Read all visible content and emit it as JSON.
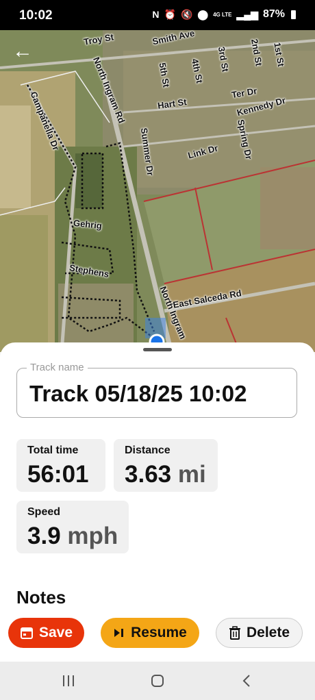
{
  "status": {
    "time": "10:02",
    "network": "4G LTE",
    "battery": "87%",
    "icons": [
      "nfc-icon",
      "alarm-icon",
      "mute-icon",
      "location-icon",
      "signal-icon",
      "battery-icon"
    ]
  },
  "map": {
    "streets": [
      "Troy St",
      "Smith Ave",
      "North Ingram Rd",
      "5th St",
      "4th St",
      "3rd St",
      "2nd St",
      "1st St",
      "Hart St",
      "Ter Dr",
      "Kennedy Dr",
      "Campanella Dr",
      "Summer Dr",
      "Link Dr",
      "Spring Dr",
      "Gehrig",
      "Stephens",
      "North Ingram",
      "East Salceda Rd"
    ]
  },
  "track": {
    "label": "Track name",
    "name": "Track 05/18/25 10:02"
  },
  "stats": {
    "total_time_label": "Total time",
    "total_time": "56:01",
    "distance_label": "Distance",
    "distance": "3.63",
    "distance_unit": "mi",
    "speed_label": "Speed",
    "speed": "3.9",
    "speed_unit": "mph"
  },
  "notes_label": "Notes",
  "buttons": {
    "save": "Save",
    "resume": "Resume",
    "delete": "Delete"
  },
  "colors": {
    "save": "#e8340a",
    "resume": "#f4a616",
    "track_line": "#111111",
    "location_dot": "#1a73e8"
  }
}
